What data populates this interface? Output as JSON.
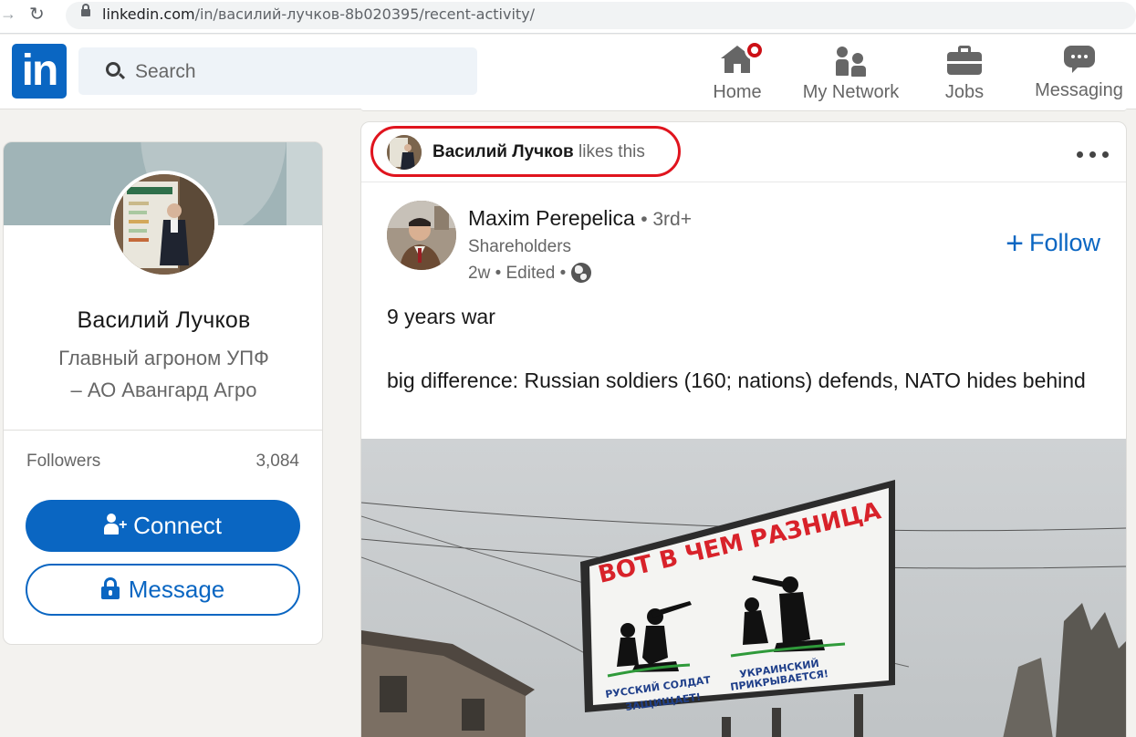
{
  "browser": {
    "url_host": "linkedin.com",
    "url_path": "/in/василий-лучков-8b020395/recent-activity/"
  },
  "nav": {
    "logo": "in",
    "search_placeholder": "Search",
    "items": [
      {
        "label": "Home",
        "icon": "home-icon"
      },
      {
        "label": "My Network",
        "icon": "network-icon"
      },
      {
        "label": "Jobs",
        "icon": "jobs-icon"
      },
      {
        "label": "Messaging",
        "icon": "messaging-icon"
      }
    ],
    "accent": "#0a66c2",
    "notification_color": "#cc1016"
  },
  "profile": {
    "name": "Василий Лучков",
    "headline_line1": "Главный агроном УПФ",
    "headline_line2": "– АО Авангард Агро",
    "followers_label": "Followers",
    "followers_count": "3,084",
    "connect_label": "Connect",
    "message_label": "Message"
  },
  "post": {
    "activity_name": "Василий Лучков",
    "activity_action": "likes this",
    "author_name": "Maxim Perepelica",
    "author_degree": "• 3rd+",
    "author_subtitle": "Shareholders",
    "meta": "2w • Edited •",
    "follow_label": "Follow",
    "text_line1": "9 years war",
    "text_line2": "big difference: Russian soldiers (160; nations) defends, NATO hides behind",
    "image": {
      "billboard_title": "ВОТ В ЧЕМ РАЗНИЦА",
      "caption_left_1": "РУССКИЙ СОЛДАТ",
      "caption_left_2": "ЗАЩИЩАЕТ!",
      "caption_right_1": "УКРАИНСКИЙ",
      "caption_right_2": "ПРИКРЫВАЕТСЯ!"
    },
    "highlight_color": "#e0141e"
  }
}
